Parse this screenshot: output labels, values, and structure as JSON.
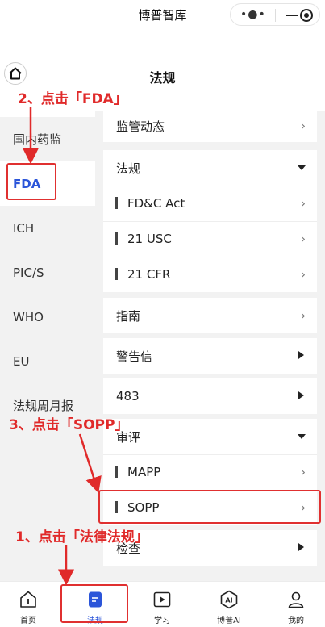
{
  "app": {
    "title": "博普智库"
  },
  "capsule": {
    "more_icon": "more-dots-icon",
    "minimize_icon": "minimize-icon",
    "close_icon": "target-close-icon"
  },
  "header": {
    "title": "法规",
    "home_icon": "home-icon"
  },
  "sidebar": {
    "items": [
      {
        "label": "国内药监",
        "active": false
      },
      {
        "label": "FDA",
        "active": true
      },
      {
        "label": "ICH",
        "active": false
      },
      {
        "label": "PIC/S",
        "active": false
      },
      {
        "label": "WHO",
        "active": false
      },
      {
        "label": "EU",
        "active": false
      },
      {
        "label": "法规周月报",
        "active": false
      }
    ]
  },
  "content": {
    "top_row": {
      "label": "监管动态",
      "indicator": "chevron-right"
    },
    "regulations": {
      "label": "法规",
      "indicator": "caret-down",
      "children": [
        {
          "label": "FD&C Act",
          "indicator": "chevron-right"
        },
        {
          "label": "21 USC",
          "indicator": "chevron-right"
        },
        {
          "label": "21 CFR",
          "indicator": "chevron-right"
        }
      ]
    },
    "guidance": {
      "label": "指南",
      "indicator": "chevron-right"
    },
    "warning_letter": {
      "label": "警告信",
      "indicator": "caret-right"
    },
    "form483": {
      "label": "483",
      "indicator": "caret-right"
    },
    "review": {
      "label": "审评",
      "indicator": "caret-down",
      "children": [
        {
          "label": "MAPP",
          "indicator": "chevron-right"
        },
        {
          "label": "SOPP",
          "indicator": "chevron-right"
        }
      ]
    },
    "inspection": {
      "label": "检查",
      "indicator": "caret-right"
    },
    "chevron_glyph": "›"
  },
  "tabbar": {
    "tabs": [
      {
        "label": "首页",
        "icon": "home-info-icon",
        "active": false
      },
      {
        "label": "法规",
        "icon": "document-icon",
        "active": true
      },
      {
        "label": "学习",
        "icon": "video-play-icon",
        "active": false
      },
      {
        "label": "博普AI",
        "icon": "ai-hexagon-icon",
        "active": false
      },
      {
        "label": "我的",
        "icon": "user-icon",
        "active": false
      }
    ]
  },
  "annotations": {
    "step1": "1、点击「法律法规」",
    "step2": "2、点击「FDA」",
    "step3": "3、点击「SOPP」",
    "color": "#e02a2a"
  },
  "colors": {
    "accent": "#2b55d9",
    "background": "#f2f2f2"
  }
}
